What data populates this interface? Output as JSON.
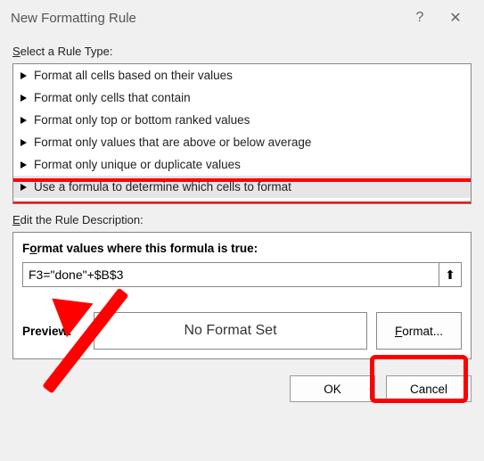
{
  "titlebar": {
    "title": "New Formatting Rule",
    "help": "?",
    "close": "✕"
  },
  "ruleTypeLabel": "Select a Rule Type:",
  "ruleItems": [
    "Format all cells based on their values",
    "Format only cells that contain",
    "Format only top or bottom ranked values",
    "Format only values that are above or below average",
    "Format only unique or duplicate values",
    "Use a formula to determine which cells to format"
  ],
  "selectedRuleIndex": 5,
  "editDescLabel": "Edit the Rule Description:",
  "formulaHeading": {
    "pre": "F",
    "u": "o",
    "post": "rmat values where this formula is true:"
  },
  "formulaValue": "F3=\"done\"+$B$3",
  "rangeGlyph": "⬆",
  "preview": {
    "label": "Preview:",
    "text": "No Format Set"
  },
  "formatBtn": {
    "u": "F",
    "post": "ormat..."
  },
  "buttons": {
    "ok": "OK",
    "cancel": "Cancel"
  }
}
